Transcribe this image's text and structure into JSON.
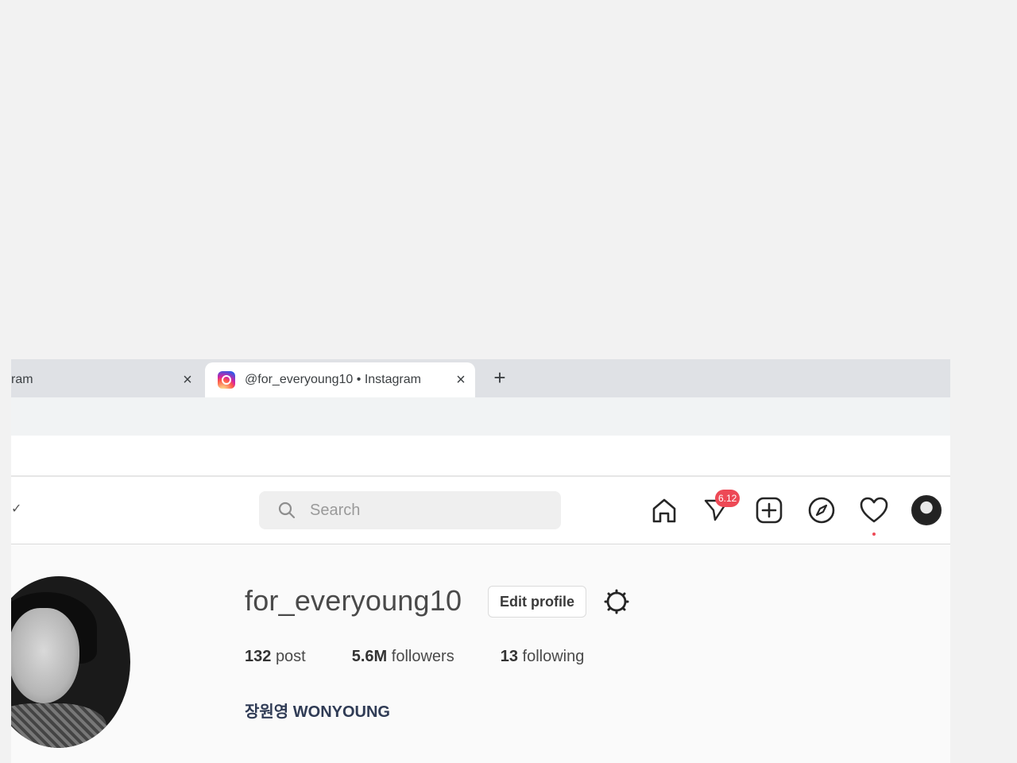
{
  "browser": {
    "tabs": [
      {
        "title": "ram",
        "active": false
      },
      {
        "title": "@for_everyoung10 • Instagram",
        "active": true
      }
    ],
    "close_glyph": "×",
    "new_tab_glyph": "+"
  },
  "nav": {
    "logo_fragment": "✓",
    "search_placeholder": "Search",
    "messages_badge": "6.12",
    "icons": [
      "home-icon",
      "direct-message-icon",
      "new-post-icon",
      "explore-icon",
      "activity-heart-icon",
      "profile-avatar"
    ]
  },
  "profile": {
    "username": "for_everyoung10",
    "edit_label": "Edit profile",
    "posts_count": "132",
    "posts_label": "post",
    "followers_count": "5.6M",
    "followers_label": "followers",
    "following_count": "13",
    "following_label": "following",
    "full_name": "장원영 WONYOUNG"
  },
  "colors": {
    "badge": "#ed4956",
    "background": "#f2f2f2",
    "name": "#2f3b55"
  }
}
